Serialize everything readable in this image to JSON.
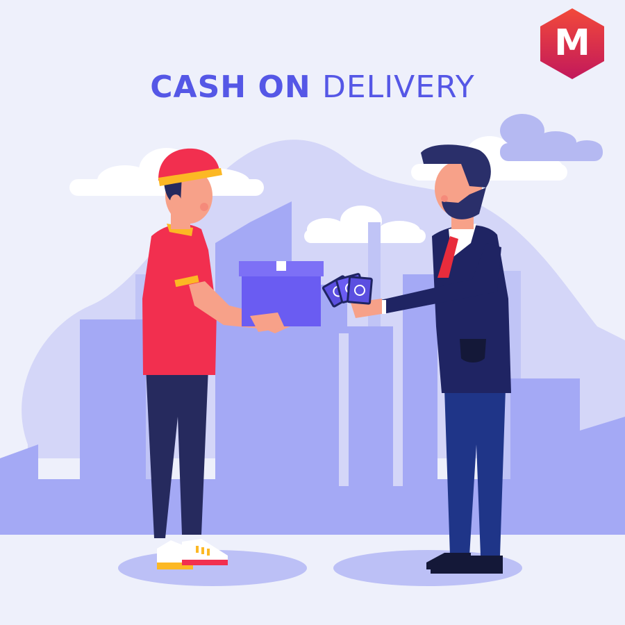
{
  "title": {
    "part1": "CASH ON",
    "part2": "DELIVERY"
  },
  "logo": {
    "letter": "M"
  },
  "colors": {
    "background": "#eef0fb",
    "title": "#5557e6",
    "skyline_light": "#c6c9f7",
    "skyline_mid": "#a3a8f5",
    "box": "#6a5cf2",
    "courier_shirt": "#f22f4f",
    "courier_cap": "#f22f4f",
    "courier_trim": "#fcb824",
    "customer_suit": "#1f2463",
    "customer_tie": "#e82c3c",
    "money": "#5b4fe0",
    "logo_top": "#f23a3a",
    "logo_bottom": "#c2185b"
  }
}
